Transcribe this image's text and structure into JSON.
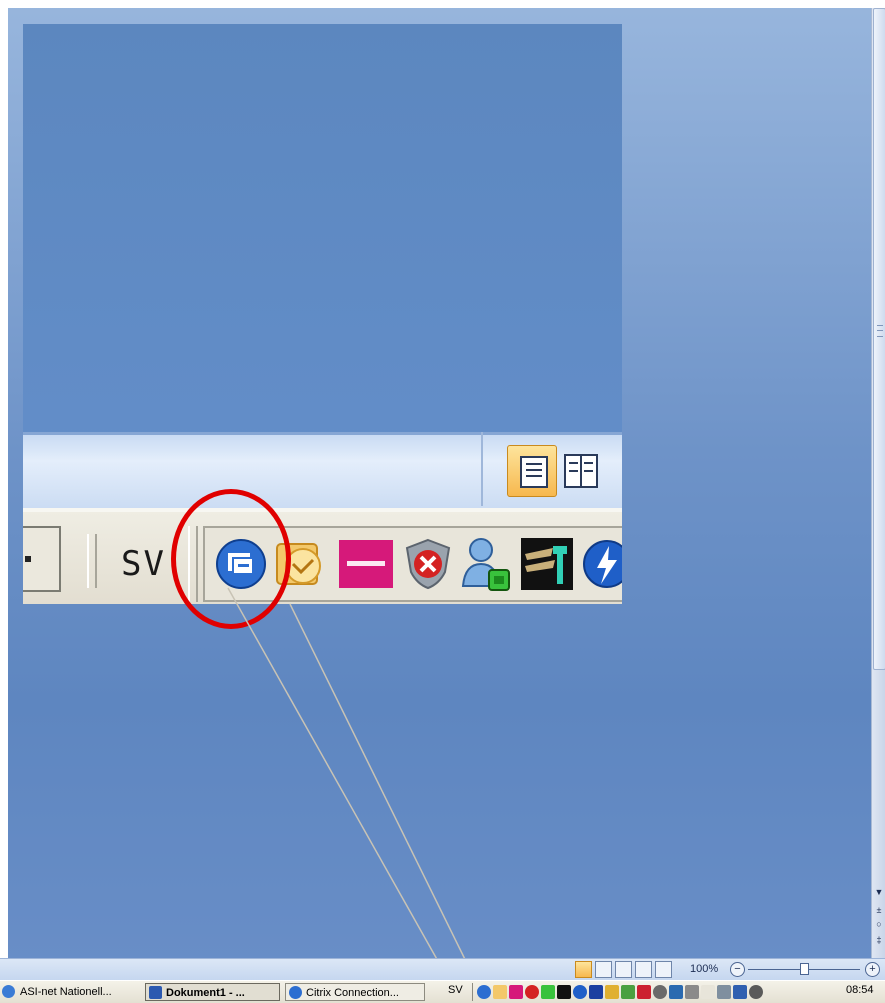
{
  "inset": {
    "language": "SV"
  },
  "status_bar": {
    "zoom": "100%",
    "minus": "−",
    "plus": "+"
  },
  "taskbar": {
    "items": [
      {
        "label": "ASI-net Nationell..."
      },
      {
        "label": "Dokument1 - ..."
      },
      {
        "label": "Citrix Connection..."
      }
    ],
    "language": "SV",
    "clock": "08:54"
  },
  "colors": {
    "highlight_circle": "#e00000",
    "active_view": "#f7b84e",
    "citrix_icon": "#2c6ed1",
    "telia": "#d6197a"
  }
}
